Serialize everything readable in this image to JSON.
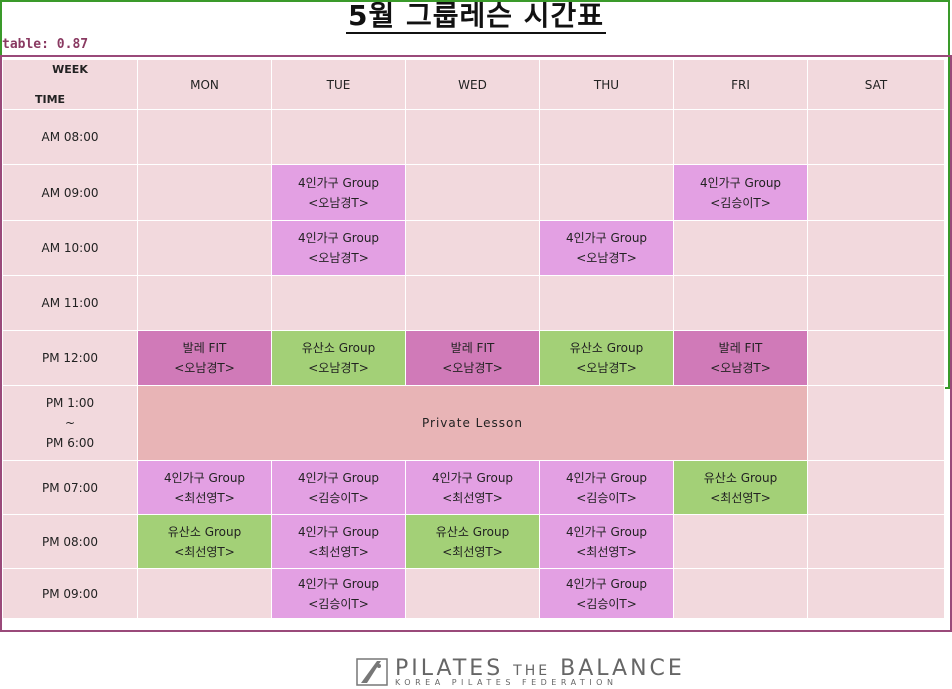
{
  "title": "5월   그룹레슨 시간표",
  "detection_label": "table: 0.87",
  "header": {
    "week": "WEEK",
    "time": "TIME",
    "days": [
      "MON",
      "TUE",
      "WED",
      "THU",
      "FRI",
      "SAT"
    ]
  },
  "rows": [
    {
      "time": "AM  08:00",
      "cells": [
        null,
        null,
        null,
        null,
        null,
        null
      ]
    },
    {
      "time": "AM  09:00",
      "cells": [
        null,
        {
          "l1": "4인가구 Group",
          "l2": "<오남경T>",
          "color": "purple"
        },
        null,
        null,
        {
          "l1": "4인가구 Group",
          "l2": "<김승이T>",
          "color": "purple"
        },
        null
      ]
    },
    {
      "time": "AM  10:00",
      "cells": [
        null,
        {
          "l1": "4인가구 Group",
          "l2": "<오남경T>",
          "color": "purple"
        },
        null,
        {
          "l1": "4인가구 Group",
          "l2": "<오남경T>",
          "color": "purple"
        },
        null,
        null
      ]
    },
    {
      "time": "AM  11:00",
      "cells": [
        null,
        null,
        null,
        null,
        null,
        null
      ]
    },
    {
      "time": "PM  12:00",
      "cells": [
        {
          "l1": "발레 FIT",
          "l2": "<오남경T>",
          "color": "magenta"
        },
        {
          "l1": "유산소 Group",
          "l2": "<오남경T>",
          "color": "green"
        },
        {
          "l1": "발레 FIT",
          "l2": "<오남경T>",
          "color": "magenta"
        },
        {
          "l1": "유산소 Group",
          "l2": "<오남경T>",
          "color": "green"
        },
        {
          "l1": "발레 FIT",
          "l2": "<오남경T>",
          "color": "magenta"
        },
        null
      ]
    }
  ],
  "private_row": {
    "time_start": "PM  1:00",
    "time_sep": "~",
    "time_end": "PM  6:00",
    "label": "Private  Lesson"
  },
  "rows_after": [
    {
      "time": "PM  07:00",
      "cells": [
        {
          "l1": "4인가구 Group",
          "l2": "<최선영T>",
          "color": "purple"
        },
        {
          "l1": "4인가구 Group",
          "l2": "<김승이T>",
          "color": "purple"
        },
        {
          "l1": "4인가구 Group",
          "l2": "<최선영T>",
          "color": "purple"
        },
        {
          "l1": "4인가구 Group",
          "l2": "<김승이T>",
          "color": "purple"
        },
        {
          "l1": "유산소 Group",
          "l2": "<최선영T>",
          "color": "green"
        },
        null
      ]
    },
    {
      "time": "PM  08:00",
      "cells": [
        {
          "l1": "유산소 Group",
          "l2": "<최선영T>",
          "color": "green"
        },
        {
          "l1": "4인가구 Group",
          "l2": "<최선영T>",
          "color": "purple"
        },
        {
          "l1": "유산소 Group",
          "l2": "<최선영T>",
          "color": "green"
        },
        {
          "l1": "4인가구 Group",
          "l2": "<최선영T>",
          "color": "purple"
        },
        null,
        null
      ]
    },
    {
      "time": "PM  09:00",
      "cells": [
        null,
        {
          "l1": "4인가구 Group",
          "l2": "<김승이T>",
          "color": "purple"
        },
        null,
        {
          "l1": "4인가구 Group",
          "l2": "<김승이T>",
          "color": "purple"
        },
        null,
        null
      ]
    }
  ],
  "footer": {
    "brand_a": "PILATES",
    "brand_the": "THE",
    "brand_b": "BALANCE",
    "sub": "KOREA PILATES FEDERATION"
  }
}
